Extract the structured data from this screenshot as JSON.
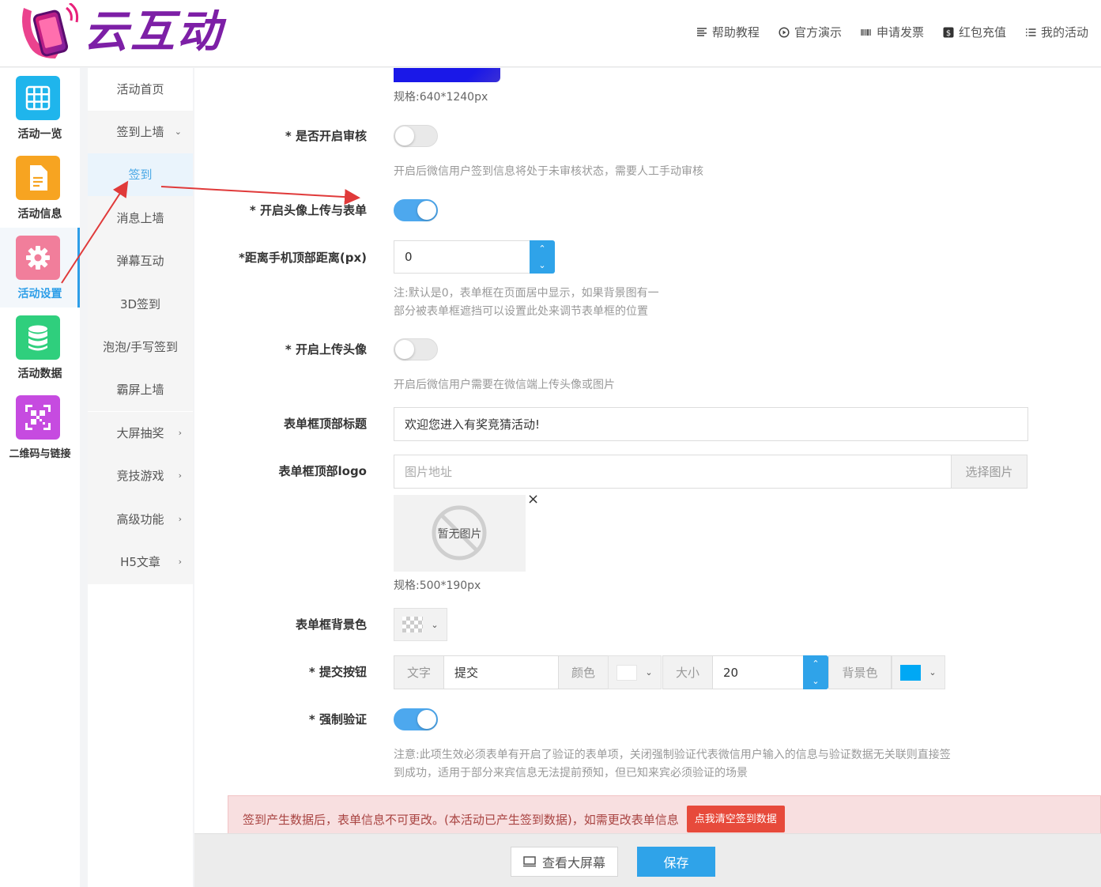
{
  "app": {
    "brand": "云互动"
  },
  "topnav": [
    {
      "label": "帮助教程",
      "icon": "list-icon"
    },
    {
      "label": "官方演示",
      "icon": "play-circle-icon"
    },
    {
      "label": "申请发票",
      "icon": "barcode-icon"
    },
    {
      "label": "红包充值",
      "icon": "dollar-icon"
    },
    {
      "label": "我的活动",
      "icon": "bullet-list-icon"
    }
  ],
  "sidebar": [
    {
      "label": "活动一览",
      "icon": "grid-icon",
      "color": "#1fb5ec"
    },
    {
      "label": "活动信息",
      "icon": "document-icon",
      "color": "#f7a421"
    },
    {
      "label": "活动设置",
      "icon": "gear-icon",
      "color": "#f17e9b",
      "active": true
    },
    {
      "label": "活动数据",
      "icon": "database-icon",
      "color": "#2fcf7d"
    },
    {
      "label": "二维码与链接",
      "icon": "qrcode-icon",
      "color": "#c64be0"
    }
  ],
  "submenu": {
    "home": "活动首页",
    "signin_wall": "签到上墙",
    "signin_children": [
      "签到",
      "消息上墙",
      "弹幕互动",
      "3D签到",
      "泡泡/手写签到",
      "霸屏上墙"
    ],
    "others": [
      "大屏抽奖",
      "竞技游戏",
      "高级功能",
      "H5文章"
    ]
  },
  "form": {
    "bg_spec": "规格:640*1240px",
    "review": {
      "label": "* 是否开启审核",
      "on": false,
      "hint": "开启后微信用户签到信息将处于未审核状态，需要人工手动审核"
    },
    "avatar_form": {
      "label": "* 开启头像上传与表单",
      "on": true
    },
    "top_distance": {
      "label": "*距离手机顶部距离(px)",
      "value": "0",
      "hint": [
        "注:默认是0，表单框在页面居中显示，如果背景图有一",
        "部分被表单框遮挡可以设置此处来调节表单框的位置"
      ]
    },
    "upload_avatar": {
      "label": "* 开启上传头像",
      "on": false,
      "hint": "开启后微信用户需要在微信端上传头像或图片"
    },
    "form_title": {
      "label": "表单框顶部标题",
      "value": "欢迎您进入有奖竞猜活动!"
    },
    "form_logo": {
      "label": "表单框顶部logo",
      "placeholder": "图片地址",
      "button": "选择图片",
      "no_image": "暂无图片",
      "close": "×",
      "spec": "规格:500*190px"
    },
    "form_bg": {
      "label": "表单框背景色"
    },
    "submit": {
      "label": "* 提交按钮",
      "text_addon": "文字",
      "text_value": "提交",
      "color_addon": "颜色",
      "text_color": "#ffffff",
      "size_addon": "大小",
      "size_value": "20",
      "bg_addon": "背景色",
      "bg_color": "#00a8f4"
    },
    "force_verify": {
      "label": "* 强制验证",
      "on": true,
      "hint": [
        "注意:此项生效必须表单有开启了验证的表单项，关闭强制验证代表微信用户输入的信息与验证数据无关联则直接签",
        "到成功，适用于部分来宾信息无法提前预知，但已知来宾必须验证的场景"
      ]
    }
  },
  "alert": {
    "text": "签到产生数据后，表单信息不可更改。(本活动已产生签到数据)，如需更改表单信息",
    "button": "点我清空签到数据"
  },
  "footer": {
    "view_screen": "查看大屏幕",
    "save": "保存"
  },
  "colors": {
    "accent": "#2fa3e9",
    "annotation_arrow": "#e03a3a"
  }
}
